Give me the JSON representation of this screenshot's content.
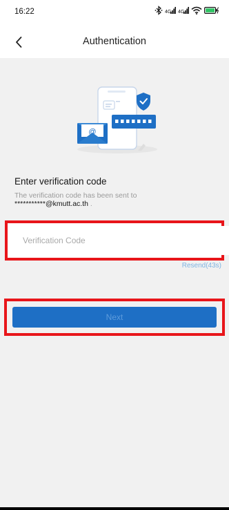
{
  "status_bar": {
    "time": "16:22",
    "icons": [
      "bluetooth-icon",
      "cell-signal-icon",
      "cell-signal-icon",
      "wifi-icon",
      "battery-charging-icon"
    ]
  },
  "header": {
    "back_icon": "chevron-left-icon",
    "title": "Authentication"
  },
  "illustration": {
    "icons": [
      "phone-icon",
      "shield-check-icon",
      "password-field-icon",
      "envelope-at-icon"
    ]
  },
  "verification": {
    "title": "Enter verification code",
    "sent_text": "The verification code has been sent to",
    "email": "***********@kmutt.ac.th",
    "email_suffix": "."
  },
  "code_field": {
    "placeholder": "Verification Code",
    "value": ""
  },
  "resend_label": "Resend(43s)",
  "next_button_label": "Next",
  "colors": {
    "accent_blue": "#1e6fc5",
    "highlight_red": "#e8151a",
    "background": "#f1f1f1",
    "resend_blue": "#7fb4e2"
  }
}
